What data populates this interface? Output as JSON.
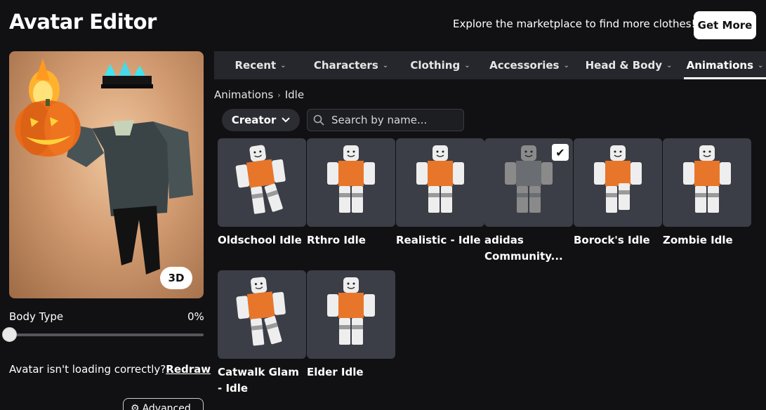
{
  "header": {
    "title": "Avatar Editor",
    "promo": "Explore the marketplace to find more clothes!",
    "get_more": "Get More"
  },
  "preview": {
    "badge": "3D"
  },
  "body_type": {
    "label": "Body Type",
    "value": "0%",
    "level": 0
  },
  "redraw": {
    "text": "Avatar isn't loading correctly?",
    "link": "Redraw"
  },
  "advanced": {
    "label": "Advanced",
    "icon": "gear-icon"
  },
  "tabs": [
    {
      "label": "Recent"
    },
    {
      "label": "Characters"
    },
    {
      "label": "Clothing"
    },
    {
      "label": "Accessories"
    },
    {
      "label": "Head & Body"
    },
    {
      "label": "Animations"
    }
  ],
  "breadcrumb": {
    "parent": "Animations",
    "current": "Idle"
  },
  "filter": {
    "creator": "Creator"
  },
  "search": {
    "placeholder": "Search by name..."
  },
  "items": [
    {
      "name": "Oldschool Idle",
      "selected": false
    },
    {
      "name": "Rthro Idle",
      "selected": false
    },
    {
      "name": "Realistic - Idle",
      "selected": false
    },
    {
      "name": "adidas Community...",
      "selected": true
    },
    {
      "name": "Borock's Idle",
      "selected": false
    },
    {
      "name": "Zombie Idle",
      "selected": false
    },
    {
      "name": "Catwalk Glam - Idle",
      "selected": false
    },
    {
      "name": "Elder Idle",
      "selected": false
    }
  ],
  "colors": {
    "background": "#111113",
    "tabbar": "#25272c",
    "card": "#3c3e47",
    "shirt": "#e8762a"
  }
}
